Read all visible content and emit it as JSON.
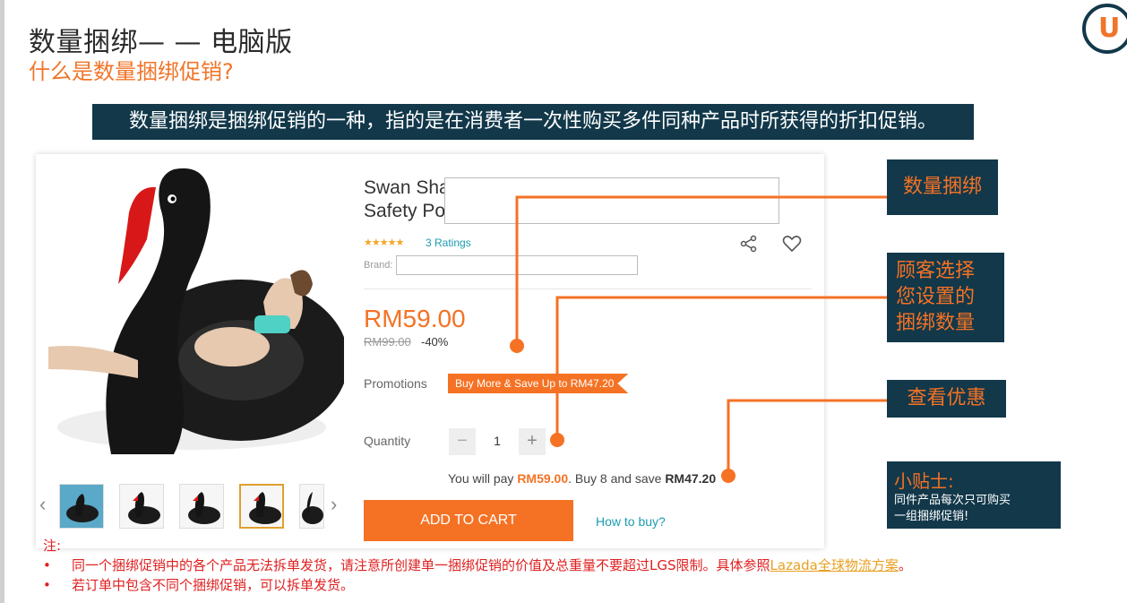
{
  "slide": {
    "title": "数量捆绑— — 电脑版",
    "subtitle": "什么是数量捆绑促销?",
    "banner": "数量捆绑是捆绑促销的一种，指的是在消费者一次性购买多件同种产品时所获得的折扣促销。"
  },
  "product": {
    "title_line1": "Swan Sha",
    "title_line2": "Safety Po",
    "stars": "★★★★★",
    "ratings": "3 Ratings",
    "brand_label": "Brand:",
    "price": "RM59.00",
    "old_price": "RM99.00",
    "discount": "-40%",
    "promotions_label": "Promotions",
    "promo_tag": "Buy More & Save Up to RM47.20",
    "quantity_label": "Quantity",
    "quantity_minus": "−",
    "quantity_value": "1",
    "quantity_plus": "+",
    "savings_prefix": "You will pay ",
    "savings_pay": "RM59.00",
    "savings_mid": ". Buy 8 and save ",
    "savings_amount": "RM47.20",
    "add_to_cart": "ADD TO CART",
    "how_to_buy": "How to buy?",
    "thumb_prev": "‹",
    "thumb_next": "›"
  },
  "callouts": {
    "bundle": "数量捆绑",
    "choose_line1": "顾客选择",
    "choose_line2": "您设置的",
    "choose_line3": "捆绑数量",
    "view_offer": "查看优惠",
    "tip_title": "小贴士:",
    "tip_line1": "同件产品每次只可购买",
    "tip_line2": "一组捆绑促销!"
  },
  "notes": {
    "heading": "注:",
    "item1_text": "同一个捆绑促销中的各个产品无法拆单发货，请注意所创建单一捆绑促销的价值及总重量不要超过LGS限制。具体参照",
    "item1_link": "Lazada全球物流方案",
    "item1_end": "。",
    "item2_text": "若订单中包含不同个捆绑促销，可以拆单发货。"
  },
  "colors": {
    "accent": "#f57224",
    "navy": "#12384a",
    "note_red": "#e02020",
    "link_teal": "#1a9cb0"
  },
  "icons": {
    "share": "share-icon",
    "heart": "heart-icon",
    "logo": "logo-u-icon"
  }
}
